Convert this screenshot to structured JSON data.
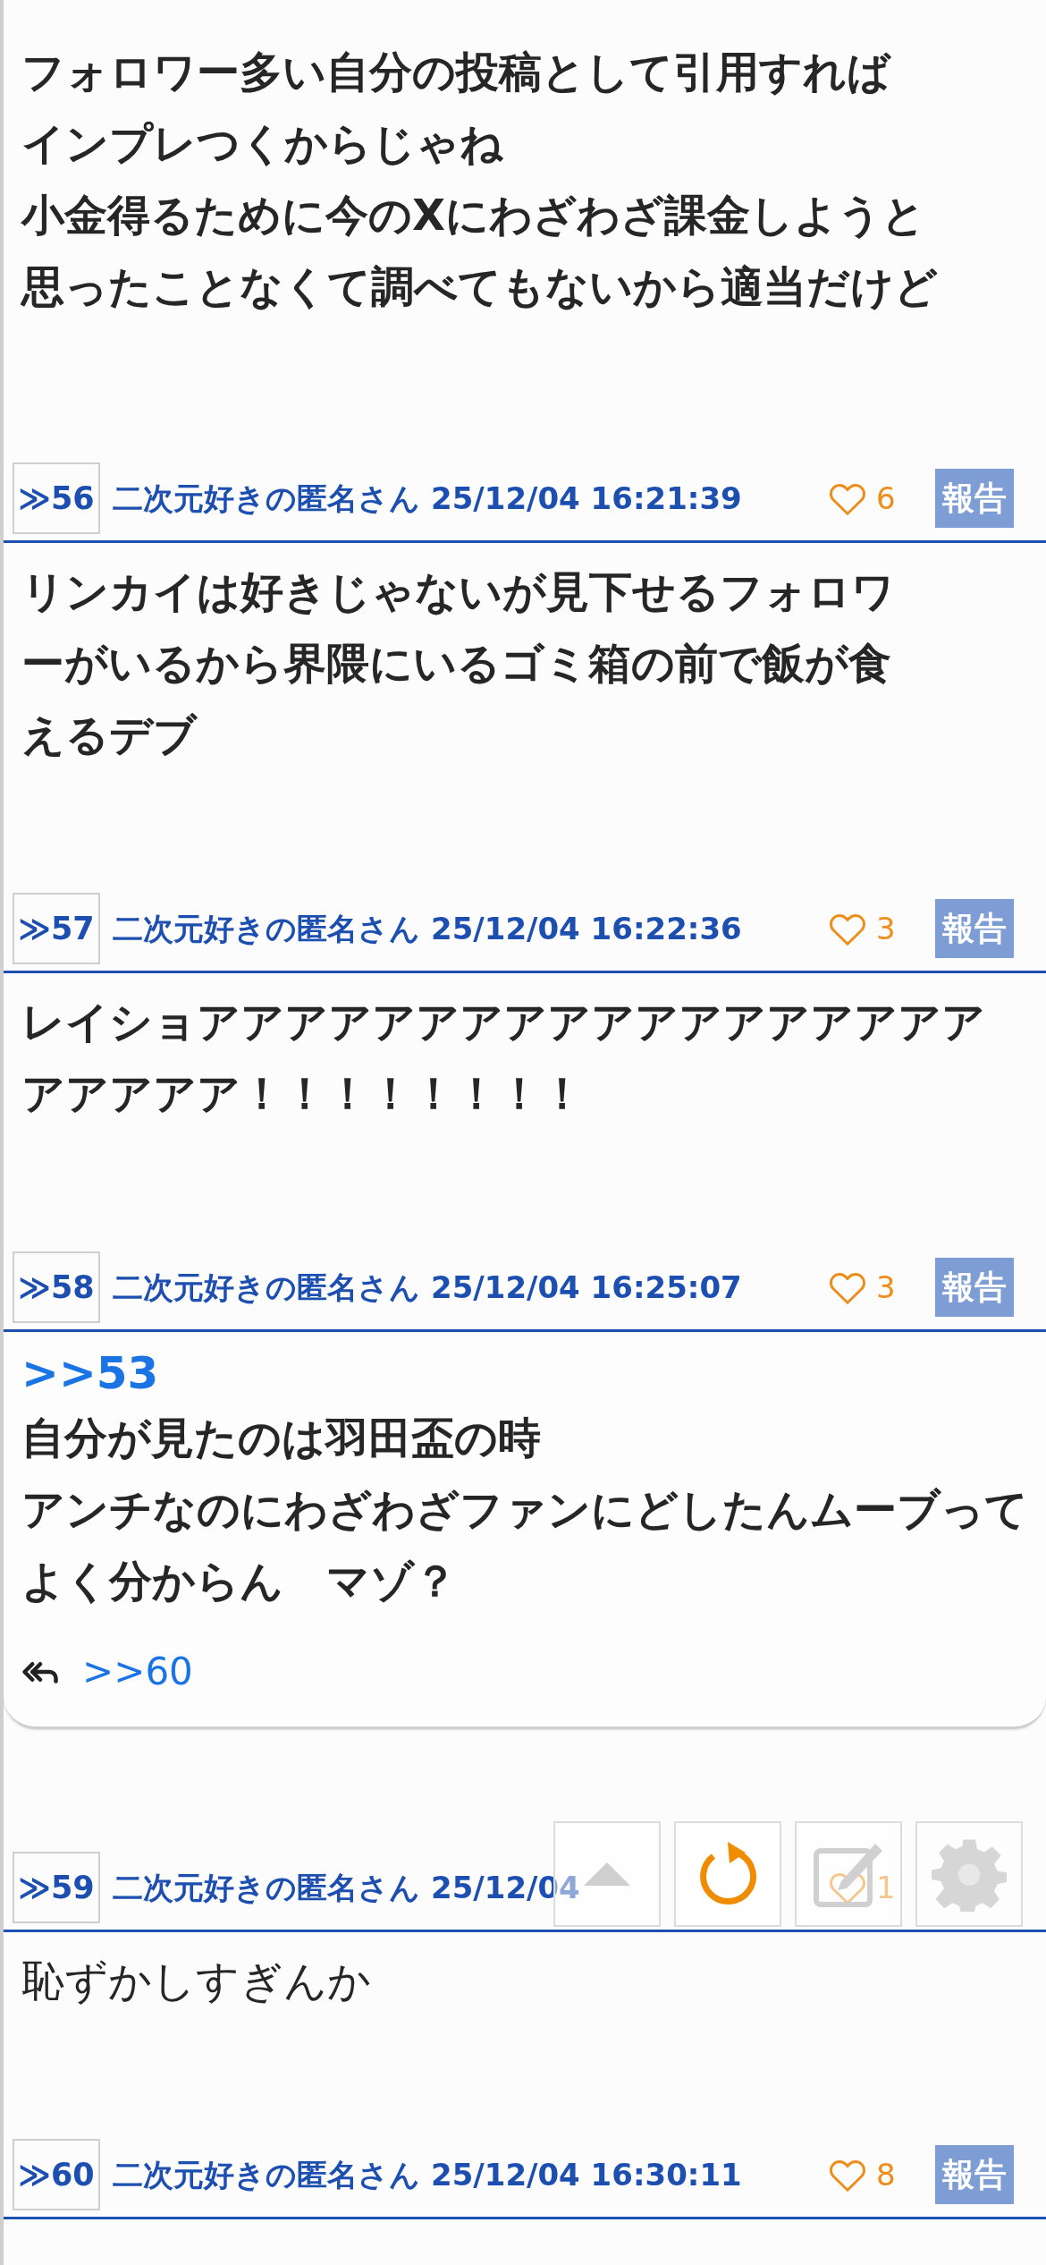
{
  "posts": [
    {
      "bold": true,
      "lines": [
        "フォロワー多い自分の投稿として引用すれば",
        "インプレつくからじゃね",
        "小金得るために今のXにわざわざ課金しようと",
        "思ったことなくて調べてもないから適当だけど"
      ]
    },
    {
      "header": {
        "number": "≫56",
        "name": "二次元好きの匿名さん",
        "date": "25/12/04 16:21:39",
        "likes": "6",
        "report": "報告"
      },
      "bold": true,
      "lines": [
        "リンカイは好きじゃないが見下せるフォロワ",
        "ーがいるから界隈にいるゴミ箱の前で飯が食",
        "えるデブ"
      ]
    },
    {
      "header": {
        "number": "≫57",
        "name": "二次元好きの匿名さん",
        "date": "25/12/04 16:22:36",
        "likes": "3",
        "report": "報告"
      },
      "bold": true,
      "lines": [
        "レイショアアアアアアアアアアアアアアアアアア",
        "アアアアア！！！！！！！！"
      ]
    },
    {
      "header": {
        "number": "≫58",
        "name": "二次元好きの匿名さん",
        "date": "25/12/04 16:25:07",
        "likes": "3",
        "report": "報告"
      },
      "kind": "card",
      "quote": ">>53",
      "bold": true,
      "lines": [
        "自分が見たのは羽田盃の時",
        "アンチなのにわざわざファンにどしたんムーブって",
        "よく分からん　マゾ？"
      ],
      "replies": [
        ">>60"
      ]
    },
    {
      "header": {
        "number": "≫59",
        "name": "二次元好きの匿名さん",
        "date": "25/12/04",
        "likes": "1"
      },
      "bold": false,
      "lines": [
        "恥ずかしすぎんか"
      ]
    },
    {
      "header": {
        "number": "≫60",
        "name": "二次元好きの匿名さん",
        "date": "25/12/04 16:30:11",
        "likes": "8",
        "report": "報告"
      }
    }
  ]
}
